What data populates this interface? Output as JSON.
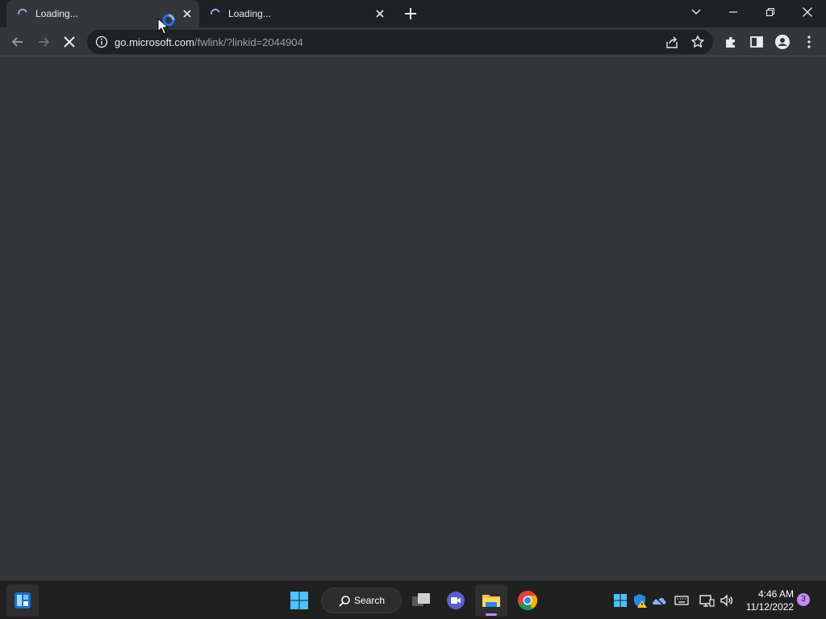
{
  "tabs": [
    {
      "title": "Loading...",
      "active": true
    },
    {
      "title": "Loading...",
      "active": false
    }
  ],
  "omnibox": {
    "host": "go.microsoft.com",
    "path": "/fwlink/?linkid=2044904"
  },
  "taskbar": {
    "search_label": "Search",
    "time": "4:46 AM",
    "date": "11/12/2022",
    "notification_count": "3"
  },
  "colors": {
    "tabstrip_bg": "#202124",
    "toolbar_bg": "#35363a",
    "taskbar_bg": "#202020",
    "accent": "#8ab4f8",
    "badge": "#c58af9"
  }
}
